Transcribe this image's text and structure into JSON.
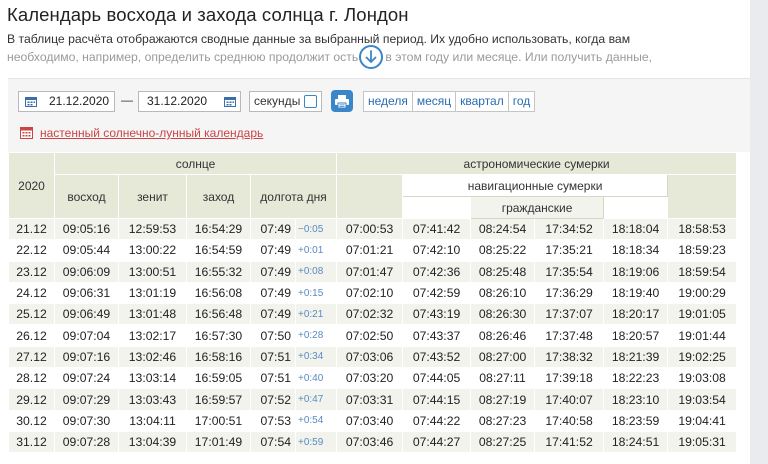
{
  "title": "Календарь восхода и захода солнца г. Лондон",
  "intro": {
    "line1": "В таблице расчёта отображаются сводные данные за выбранный период. Их удобно использовать, когда вам",
    "line2": "необходимо, например, определить среднюю продолжит    ость дня в этом году или месяце. Или получить данные,"
  },
  "controls": {
    "date_from": "21.12.2020",
    "date_to": "31.12.2020",
    "dash": "—",
    "seconds_label": "секунды",
    "periods": [
      "неделя",
      "месяц",
      "квартал",
      "год"
    ],
    "calendar_link": "настенный солнечно-лунный календарь"
  },
  "table": {
    "year": "2020",
    "sun_header": "солнце",
    "astro_header": "астрономические сумерки",
    "nav_header": "навигационные сумерки",
    "civil_header": "гражданские",
    "cols": [
      "восход",
      "зенит",
      "заход",
      "долгота дня"
    ],
    "rows": [
      {
        "d": "21.12",
        "rise": "09:05:16",
        "zen": "12:59:53",
        "set": "16:54:29",
        "len": "07:49",
        "diff": "−0:05",
        "c": [
          "07:00:53",
          "07:41:42",
          "08:24:54",
          "17:34:52",
          "18:18:04",
          "18:58:53"
        ]
      },
      {
        "d": "22.12",
        "rise": "09:05:44",
        "zen": "13:00:22",
        "set": "16:54:59",
        "len": "07:49",
        "diff": "+0:01",
        "c": [
          "07:01:21",
          "07:42:10",
          "08:25:22",
          "17:35:21",
          "18:18:34",
          "18:59:23"
        ]
      },
      {
        "d": "23.12",
        "rise": "09:06:09",
        "zen": "13:00:51",
        "set": "16:55:32",
        "len": "07:49",
        "diff": "+0:08",
        "c": [
          "07:01:47",
          "07:42:36",
          "08:25:48",
          "17:35:54",
          "18:19:06",
          "18:59:54"
        ]
      },
      {
        "d": "24.12",
        "rise": "09:06:31",
        "zen": "13:01:19",
        "set": "16:56:08",
        "len": "07:49",
        "diff": "+0:15",
        "c": [
          "07:02:10",
          "07:42:59",
          "08:26:10",
          "17:36:29",
          "18:19:40",
          "19:00:29"
        ]
      },
      {
        "d": "25.12",
        "rise": "09:06:49",
        "zen": "13:01:48",
        "set": "16:56:48",
        "len": "07:49",
        "diff": "+0:21",
        "c": [
          "07:02:32",
          "07:43:19",
          "08:26:30",
          "17:37:07",
          "18:20:17",
          "19:01:05"
        ]
      },
      {
        "d": "26.12",
        "rise": "09:07:04",
        "zen": "13:02:17",
        "set": "16:57:30",
        "len": "07:50",
        "diff": "+0:28",
        "c": [
          "07:02:50",
          "07:43:37",
          "08:26:46",
          "17:37:48",
          "18:20:57",
          "19:01:44"
        ]
      },
      {
        "d": "27.12",
        "rise": "09:07:16",
        "zen": "13:02:46",
        "set": "16:58:16",
        "len": "07:51",
        "diff": "+0:34",
        "c": [
          "07:03:06",
          "07:43:52",
          "08:27:00",
          "17:38:32",
          "18:21:39",
          "19:02:25"
        ]
      },
      {
        "d": "28.12",
        "rise": "09:07:24",
        "zen": "13:03:14",
        "set": "16:59:05",
        "len": "07:51",
        "diff": "+0:40",
        "c": [
          "07:03:20",
          "07:44:05",
          "08:27:11",
          "17:39:18",
          "18:22:23",
          "19:03:08"
        ]
      },
      {
        "d": "29.12",
        "rise": "09:07:29",
        "zen": "13:03:43",
        "set": "16:59:57",
        "len": "07:52",
        "diff": "+0:47",
        "c": [
          "07:03:31",
          "07:44:15",
          "08:27:19",
          "17:40:07",
          "18:23:10",
          "19:03:54"
        ]
      },
      {
        "d": "30.12",
        "rise": "09:07:30",
        "zen": "13:04:11",
        "set": "17:00:51",
        "len": "07:53",
        "diff": "+0:54",
        "c": [
          "07:03:40",
          "07:44:22",
          "08:27:23",
          "17:40:58",
          "18:23:59",
          "19:04:41"
        ]
      },
      {
        "d": "31.12",
        "rise": "09:07:28",
        "zen": "13:04:39",
        "set": "17:01:49",
        "len": "07:54",
        "diff": "+0:59",
        "c": [
          "07:03:46",
          "07:44:27",
          "08:27:25",
          "17:41:52",
          "18:24:51",
          "19:05:31"
        ]
      }
    ]
  },
  "colors": {
    "accent": "#3a86c8",
    "link_red": "#cc4444",
    "header_bg": "#e6e8d8",
    "row_alt": "#f2f3ec"
  }
}
